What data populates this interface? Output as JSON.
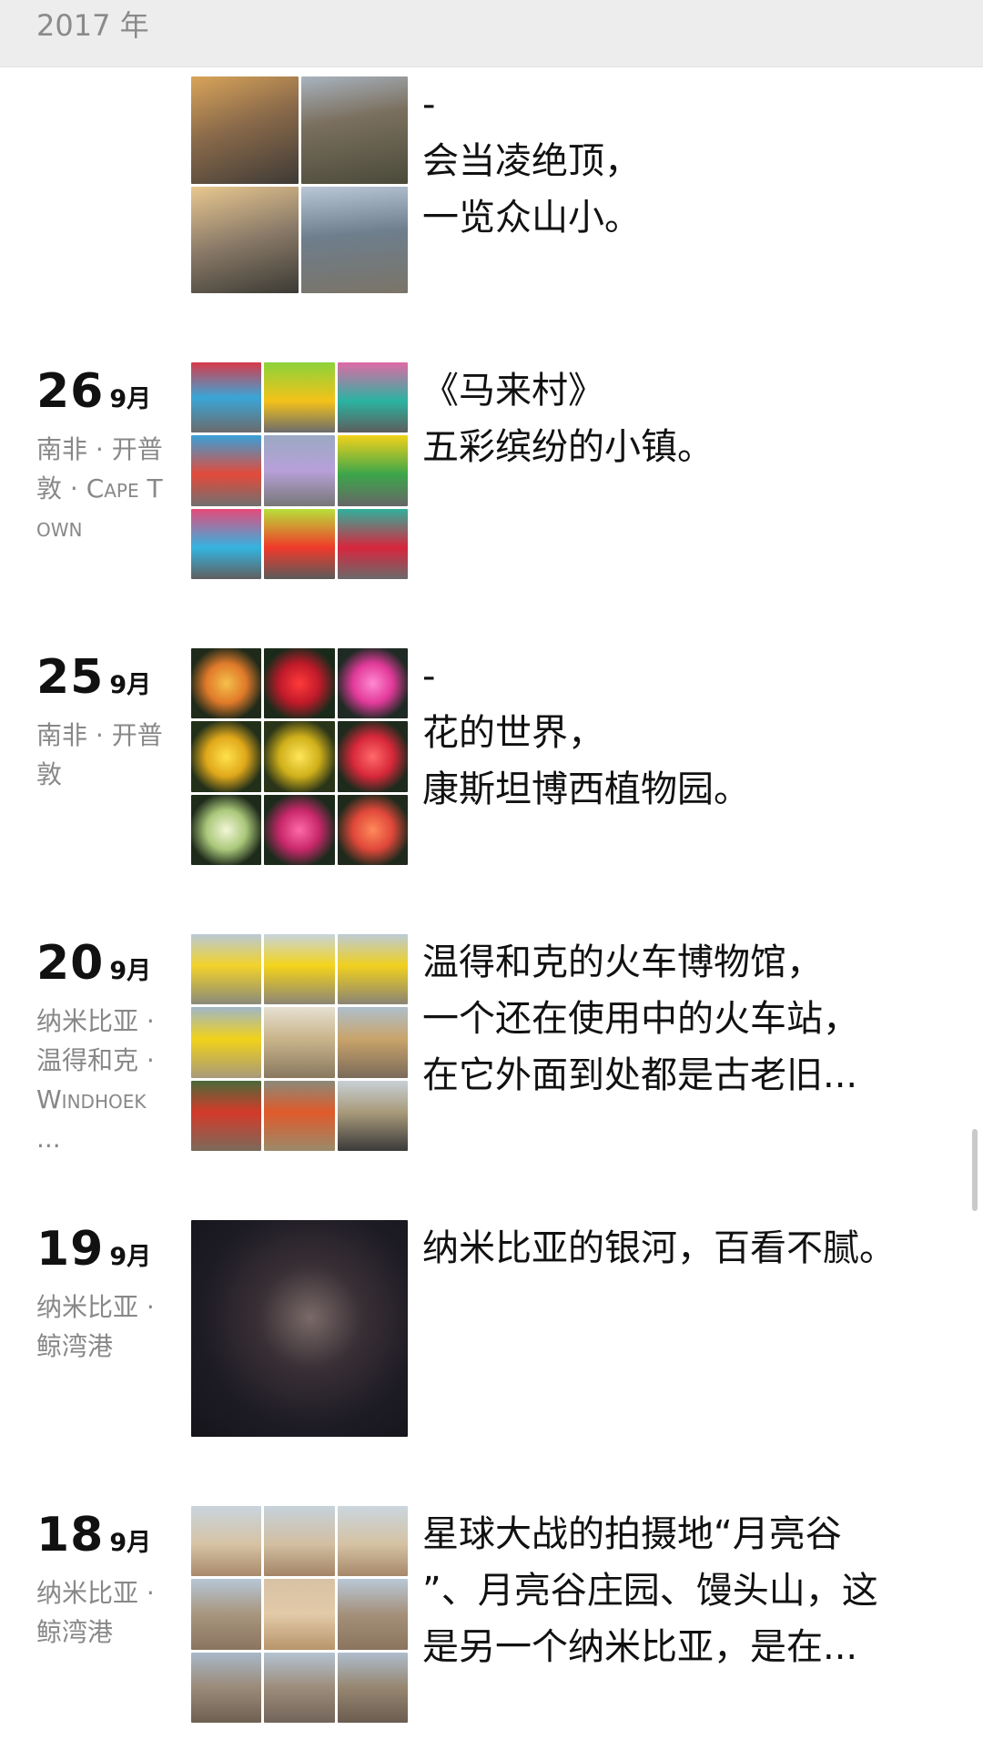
{
  "year_header": "2017 年",
  "posts": [
    {
      "day": "",
      "month": "",
      "location": "",
      "grid": 2,
      "photos": [
        "linear-gradient(160deg,#d9a45a 0%,#8a6a4a 45%,#3e3a36 100%)",
        "linear-gradient(170deg,#a8b3bf 0%,#7b705f 40%,#4a4a3a 100%)",
        "linear-gradient(165deg,#e9c890 0%,#8a7a68 50%,#3b3a34 100%)",
        "linear-gradient(175deg,#b9c7d6 0%,#6e7e8c 45%,#7a7468 100%)"
      ],
      "caption": [
        "-",
        "会当凌绝顶，",
        "一览众山小。"
      ]
    },
    {
      "day": "26",
      "month": "9月",
      "location": "南非 · 开普敦 · Cape Town",
      "grid": 3,
      "photos": [
        "linear-gradient(180deg,#d83a4a 0%,#3aa6d8 50%,#6b6b6b 100%)",
        "linear-gradient(180deg,#8bd33a 0%,#f4c21a 55%,#6c6c6c 100%)",
        "linear-gradient(180deg,#e06aa6 0%,#2ab3a1 55%,#5d5d5d 100%)",
        "linear-gradient(180deg,#39a0d8 0%,#e34a3a 55%,#707070 100%)",
        "linear-gradient(180deg,#9aa9c3 0%,#b7a0d8 50%,#777 100%)",
        "linear-gradient(180deg,#f2d21a 0%,#3ca64a 55%,#666 100%)",
        "linear-gradient(180deg,#e64a7a 0%,#34b4e0 55%,#5f5f5f 100%)",
        "linear-gradient(180deg,#b8e03a 0%,#f03a2a 55%,#5a5a5a 100%)",
        "linear-gradient(180deg,#2fb19c 0%,#d7263d 55%,#6a6a6a 100%)"
      ],
      "caption": [
        "《马来村》",
        "五彩缤纷的小镇。"
      ]
    },
    {
      "day": "25",
      "month": "9月",
      "location": "南非 · 开普敦",
      "grid": 3,
      "photos": [
        "radial-gradient(circle at 50% 50%,#f5c04a 0%,#e07a2a 40%,#1f2a1a 75%)",
        "radial-gradient(circle at 50% 50%,#ff3a3a 0%,#c01a2a 40%,#1a2a1a 75%)",
        "radial-gradient(circle at 50% 50%,#ff8ad0 0%,#e23a9a 40%,#1f2a24 75%)",
        "radial-gradient(circle at 50% 50%,#ffe24a 0%,#e0a81a 40%,#22301a 75%)",
        "radial-gradient(circle at 50% 50%,#ffe65a 0%,#d0b01a 40%,#2a3418 75%)",
        "radial-gradient(circle at 50% 50%,#ff6a6a 0%,#d8283a 40%,#1d2a1c 75%)",
        "radial-gradient(circle at 50% 50%,#f3f6d8 0%,#aac87a 40%,#1e2a1a 75%)",
        "radial-gradient(circle at 50% 50%,#ff6aa8 0%,#c8286a 40%,#1c2a1c 75%)",
        "radial-gradient(circle at 50% 50%,#ff8a5a 0%,#e0483a 40%,#202a1c 75%)"
      ],
      "caption": [
        "-",
        "花的世界，",
        "康斯坦博西植物园。"
      ]
    },
    {
      "day": "20",
      "month": "9月",
      "location": "纳米比亚 · 温得和克 · Windhoek ...",
      "grid": 3,
      "photos": [
        "linear-gradient(180deg,#b9c9d6 0%,#f2d22a 45%,#8a8a7a 100%)",
        "linear-gradient(180deg,#c8d4dc 0%,#f4d41a 45%,#8c8576 100%)",
        "linear-gradient(180deg,#bccbd6 0%,#f0d01e 45%,#8a8474 100%)",
        "linear-gradient(180deg,#9fb6c9 0%,#f1d21a 45%,#a89a7a 100%)",
        "linear-gradient(180deg,#e6e0d2 0%,#c9b48a 45%,#8a7860 100%)",
        "linear-gradient(180deg,#aebfcc 0%,#c9a46a 45%,#7a6a5a 100%)",
        "linear-gradient(180deg,#4a6a3a 0%,#d43a2a 45%,#7a6a5a 100%)",
        "linear-gradient(180deg,#8a8a7a 0%,#e05a2a 45%,#9a8a6a 100%)",
        "linear-gradient(180deg,#c8d0d6 0%,#a89a7a 45%,#3a3a3a 100%)"
      ],
      "caption": [
        "温得和克的火车博物馆，",
        "一个还在使用中的火车站，",
        "在它外面到处都是古老旧..."
      ]
    },
    {
      "day": "19",
      "month": "9月",
      "location": "纳米比亚 · 鲸湾港",
      "grid": 1,
      "photos": [
        "radial-gradient(ellipse at 55% 45%,#7a6a68 0%,#3a3036 30%,#1d1b24 65%,#15141a 100%)"
      ],
      "caption": [
        "纳米比亚的银河，百看不腻。"
      ]
    },
    {
      "day": "18",
      "month": "9月",
      "location": "纳米比亚 · 鲸湾港",
      "grid": 3,
      "photos": [
        "linear-gradient(180deg,#c9d4de 0%,#d6c3a4 55%,#a8896a 100%)",
        "linear-gradient(180deg,#c6d2dc 0%,#d2bea0 55%,#a48466 100%)",
        "linear-gradient(180deg,#cbd6df 0%,#d4c2a2 55%,#a6886a 100%)",
        "linear-gradient(180deg,#b6c6d6 0%,#a8967e 50%,#8a7460 100%)",
        "linear-gradient(180deg,#d8c2a4 0%,#e2caa8 50%,#b8946a 100%)",
        "linear-gradient(180deg,#b9c8d6 0%,#a4907a 50%,#8a745e 100%)",
        "linear-gradient(180deg,#a8b8c9 0%,#9a8a78 50%,#6e6052 100%)",
        "linear-gradient(180deg,#b4c3d2 0%,#9c8c7a 50%,#72645a 100%)",
        "linear-gradient(180deg,#aebdcc 0%,#968670 50%,#6a5c50 100%)"
      ],
      "caption": [
        "星球大战的拍摄地“月亮谷",
        "”、月亮谷庄园、馒头山，这",
        "是另一个纳米比亚，是在..."
      ]
    }
  ]
}
